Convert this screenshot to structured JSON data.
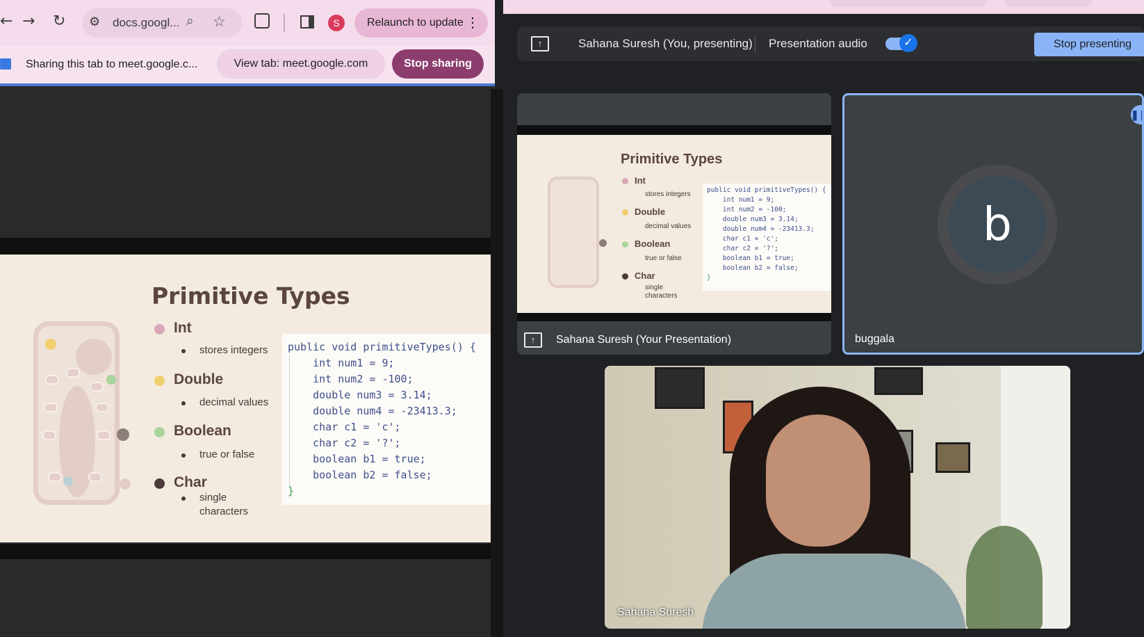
{
  "browser": {
    "url": "docs.googl...",
    "profile_initial": "S",
    "relaunch_label": "Relaunch to update",
    "share_text": "Sharing this tab to meet.google.c...",
    "view_tab_label": "View tab: meet.google.com",
    "stop_sharing_label": "Stop sharing"
  },
  "slide": {
    "title": "Primitive Types",
    "items": [
      {
        "label": "Int",
        "desc": "stores integers",
        "color": "#d9a8b8"
      },
      {
        "label": "Double",
        "desc": "decimal values",
        "color": "#f2cf6e"
      },
      {
        "label": "Boolean",
        "desc": "true or false",
        "color": "#a9d59c"
      },
      {
        "label": "Char",
        "desc": "single",
        "desc2": "characters",
        "color": "#4a3b38"
      }
    ],
    "code": [
      "public void primitiveTypes() {",
      "    int num1 = 9;",
      "    int num2 = -100;",
      "    double num3 = 3.14;",
      "    double num4 = -23413.3;",
      "    char c1 = 'c';",
      "    char c2 = '?';",
      "    boolean b1 = true;",
      "    boolean b2 = false;",
      "}"
    ]
  },
  "meet": {
    "presenter_label": "Sahana Suresh (You, presenting)",
    "presentation_audio_label": "Presentation audio",
    "stop_presenting_label": "Stop presenting",
    "presentation_tile_label": "Sahana Suresh (Your Presentation)",
    "participant_name": "buggala",
    "participant_initial": "b",
    "video_name": "Sahana Suresh"
  }
}
